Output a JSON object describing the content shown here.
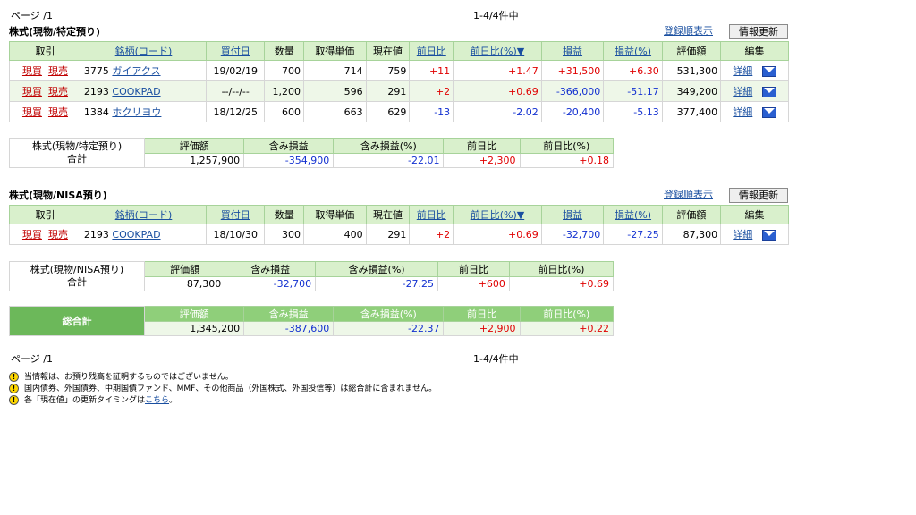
{
  "pager": {
    "page": "ページ /1",
    "range": "1-4/4件中"
  },
  "sections": [
    {
      "title": "株式(現物/特定預り)",
      "sort_link": "登録順表示",
      "refresh": "情報更新",
      "headers": [
        "取引",
        "銘柄(コード)",
        "買付日",
        "数量",
        "取得単価",
        "現在値",
        "前日比",
        "前日比(%)▼",
        "損益",
        "損益(%)",
        "評価額",
        "編集"
      ],
      "rows": [
        {
          "buy": "現買",
          "sell": "現売",
          "code": "3775",
          "name": "ガイアクス",
          "date": "19/02/19",
          "qty": "700",
          "cost": "714",
          "price": "759",
          "chg": "+11",
          "chgpct": "+1.47",
          "pl": "+31,500",
          "plpct": "+6.30",
          "value": "531,300",
          "detail": "詳細"
        },
        {
          "buy": "現買",
          "sell": "現売",
          "code": "2193",
          "name": "COOKPAD",
          "date": "--/--/--",
          "qty": "1,200",
          "cost": "596",
          "price": "291",
          "chg": "+2",
          "chgpct": "+0.69",
          "pl": "-366,000",
          "plpct": "-51.17",
          "value": "349,200",
          "detail": "詳細"
        },
        {
          "buy": "現買",
          "sell": "現売",
          "code": "1384",
          "name": "ホクリヨウ",
          "date": "18/12/25",
          "qty": "600",
          "cost": "663",
          "price": "629",
          "chg": "-13",
          "chgpct": "-2.02",
          "pl": "-20,400",
          "plpct": "-5.13",
          "value": "377,400",
          "detail": "詳細"
        }
      ],
      "summary": {
        "label1": "株式(現物/特定預り)",
        "label2": "合計",
        "headers": [
          "評価額",
          "含み損益",
          "含み損益(%)",
          "前日比",
          "前日比(%)"
        ],
        "values": [
          "1,257,900",
          "-354,900",
          "-22.01",
          "+2,300",
          "+0.18"
        ]
      }
    },
    {
      "title": "株式(現物/NISA預り)",
      "sort_link": "登録順表示",
      "refresh": "情報更新",
      "headers": [
        "取引",
        "銘柄(コード)",
        "買付日",
        "数量",
        "取得単価",
        "現在値",
        "前日比",
        "前日比(%)▼",
        "損益",
        "損益(%)",
        "評価額",
        "編集"
      ],
      "rows": [
        {
          "buy": "現買",
          "sell": "現売",
          "code": "2193",
          "name": "COOKPAD",
          "date": "18/10/30",
          "qty": "300",
          "cost": "400",
          "price": "291",
          "chg": "+2",
          "chgpct": "+0.69",
          "pl": "-32,700",
          "plpct": "-27.25",
          "value": "87,300",
          "detail": "詳細"
        }
      ],
      "summary": {
        "label1": "株式(現物/NISA預り)",
        "label2": "合計",
        "headers": [
          "評価額",
          "含み損益",
          "含み損益(%)",
          "前日比",
          "前日比(%)"
        ],
        "values": [
          "87,300",
          "-32,700",
          "-27.25",
          "+600",
          "+0.69"
        ]
      }
    }
  ],
  "total": {
    "label": "総合計",
    "headers": [
      "評価額",
      "含み損益",
      "含み損益(%)",
      "前日比",
      "前日比(%)"
    ],
    "values": [
      "1,345,200",
      "-387,600",
      "-22.37",
      "+2,900",
      "+0.22"
    ]
  },
  "notes": [
    {
      "text": "当情報は、お預り残高を証明するものではございません。"
    },
    {
      "text": "国内債券、外国債券、中期国債ファンド、MMF、その他商品（外国株式、外国投信等）は総合計に含まれません。"
    },
    {
      "text_before": "各「現在値」の更新タイミングは",
      "link": "こちら",
      "text_after": "。"
    }
  ],
  "colors": {
    "header_bg": "#d9f0cc",
    "positive": "#e00000",
    "negative": "#1230d0",
    "link": "#1a4fa0",
    "total_bg": "#6cb85a"
  },
  "icons": {
    "mail": "mail-icon",
    "warning": "warning-icon"
  }
}
